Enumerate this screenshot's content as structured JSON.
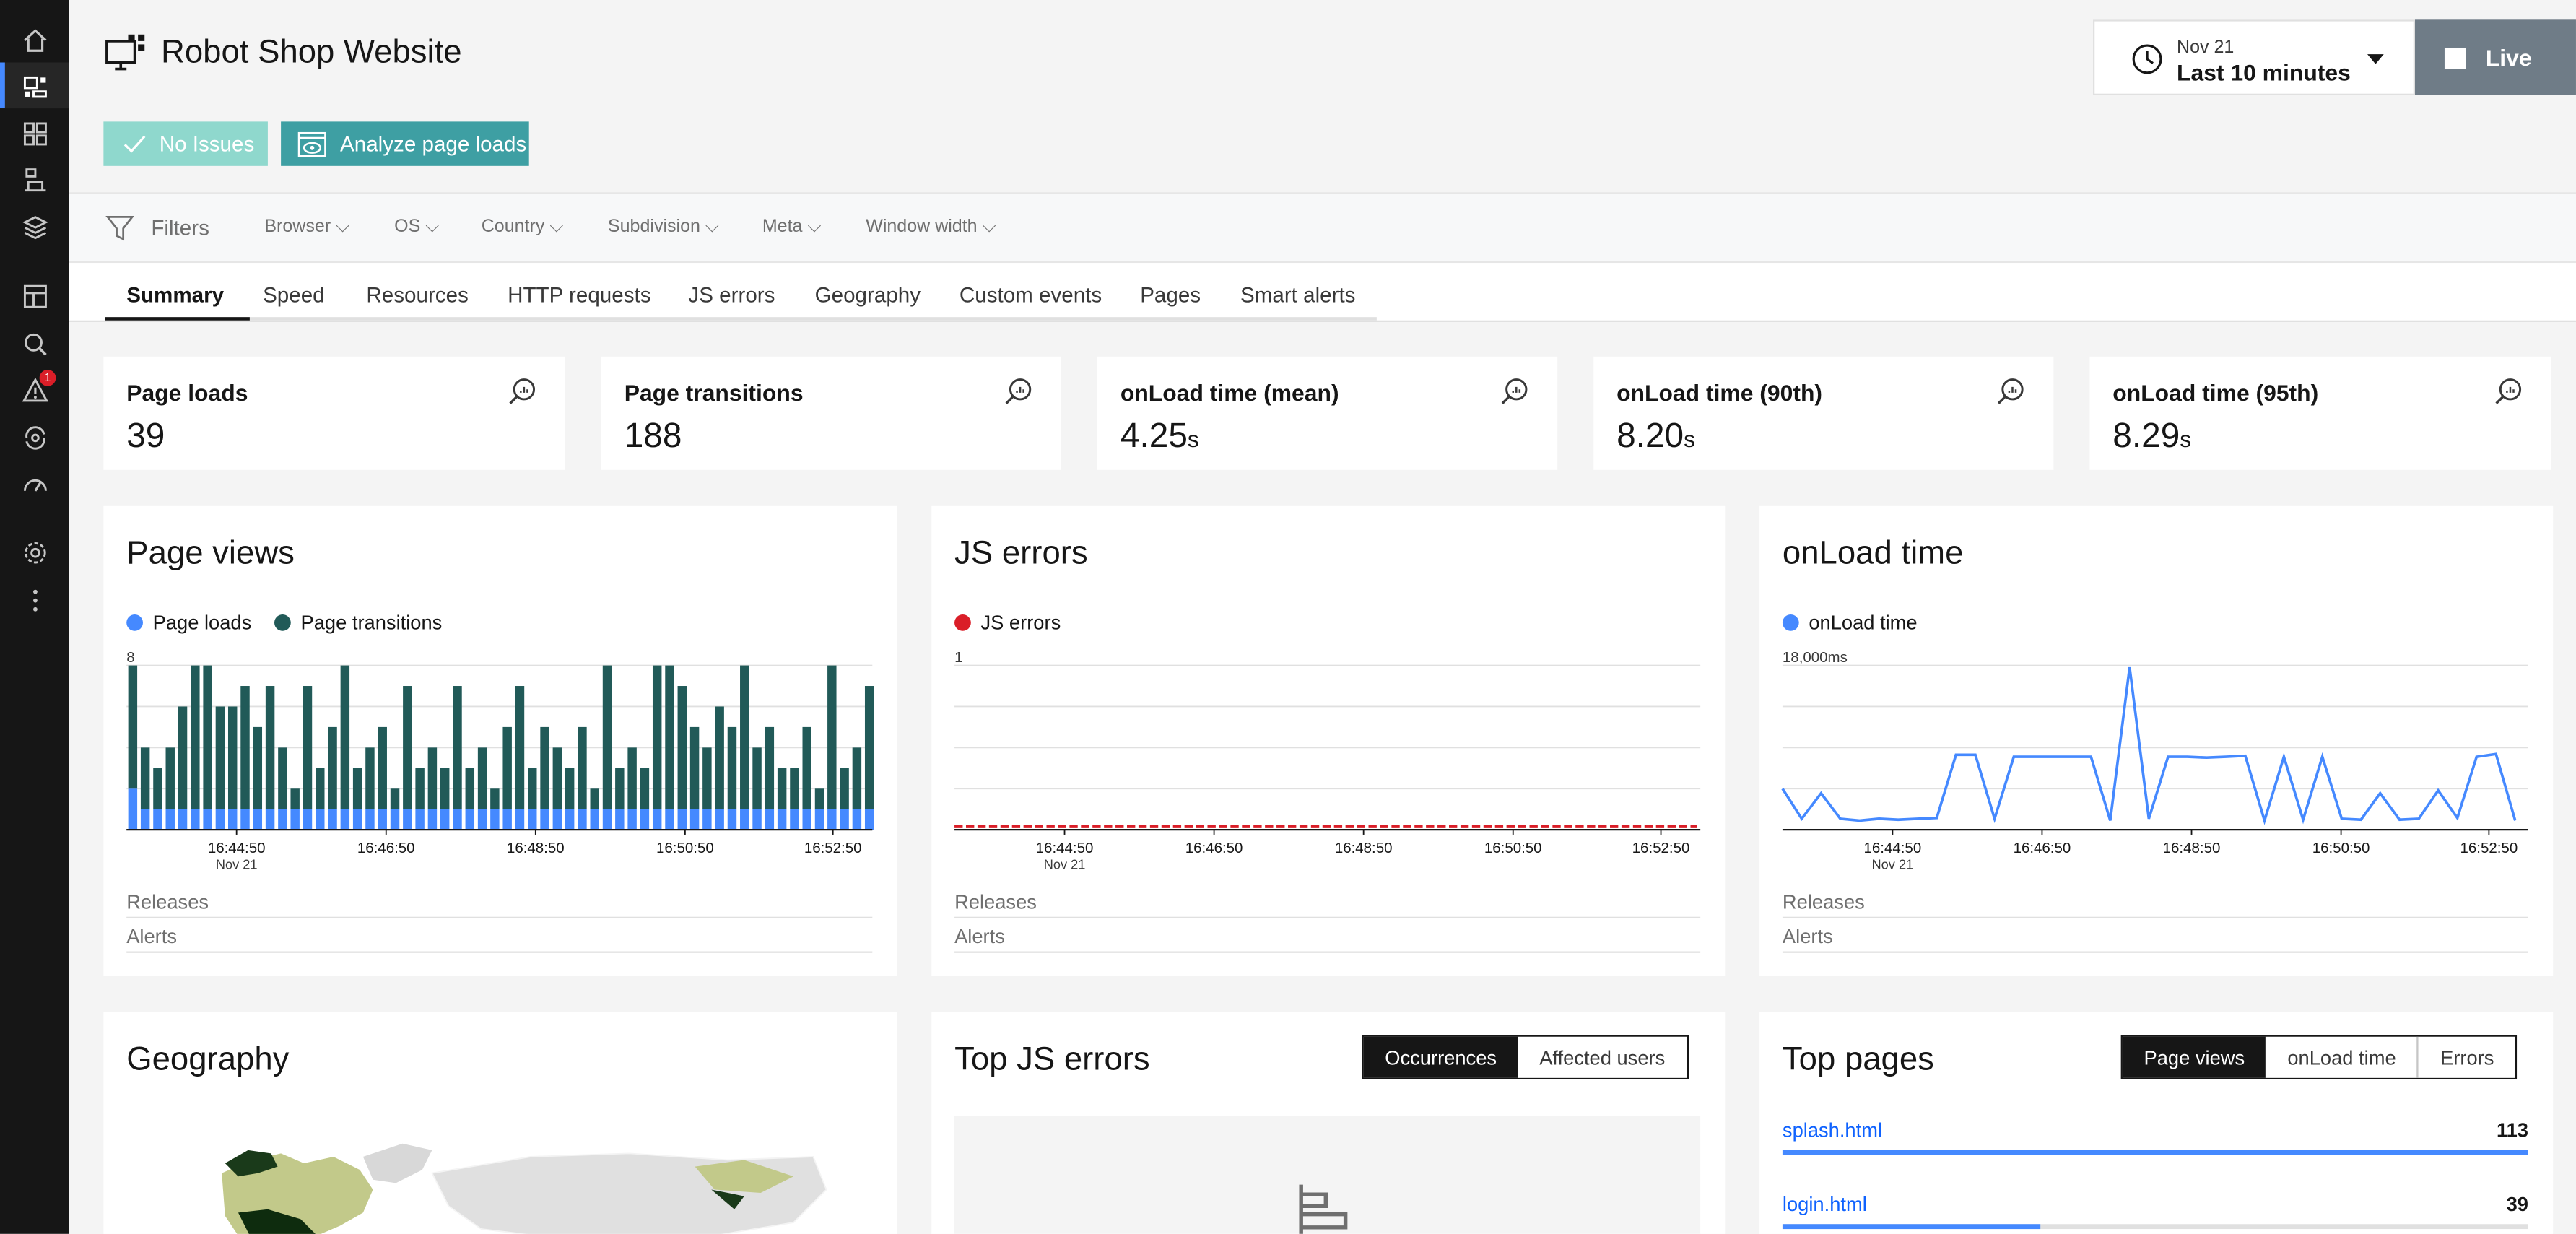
{
  "app": {
    "title": "Robot Shop Website"
  },
  "status": {
    "no_issues": "No Issues",
    "analyze": "Analyze page loads"
  },
  "time": {
    "date": "Nov 21",
    "range": "Last 10 minutes",
    "live": "Live"
  },
  "sidebar": {
    "icons": [
      "home-icon",
      "website-monitoring-icon",
      "applications-icon",
      "infrastructure-icon",
      "platforms-icon",
      "dashboards-icon",
      "analytics-icon",
      "events-icon",
      "automation-icon",
      "performance-icon",
      "settings-icon",
      "more-icon"
    ],
    "alert_count": "1"
  },
  "filters": {
    "label": "Filters",
    "items": [
      "Browser",
      "OS",
      "Country",
      "Subdivision",
      "Meta",
      "Window width"
    ]
  },
  "tabs": [
    "Summary",
    "Speed",
    "Resources",
    "HTTP requests",
    "JS errors",
    "Geography",
    "Custom events",
    "Pages",
    "Smart alerts"
  ],
  "stats": [
    {
      "label": "Page loads",
      "value": "39",
      "unit": ""
    },
    {
      "label": "Page transitions",
      "value": "188",
      "unit": ""
    },
    {
      "label": "onLoad time (mean)",
      "value": "4.25",
      "unit": "s"
    },
    {
      "label": "onLoad time (90th)",
      "value": "8.20",
      "unit": "s"
    },
    {
      "label": "onLoad time (95th)",
      "value": "8.29",
      "unit": "s"
    }
  ],
  "panels": {
    "page_views": {
      "title": "Page views",
      "legend": [
        "Page loads",
        "Page transitions"
      ],
      "ymax": "8"
    },
    "js_errors": {
      "title": "JS errors",
      "legend": [
        "JS errors"
      ],
      "ymax": "1"
    },
    "onload": {
      "title": "onLoad time",
      "legend": [
        "onLoad time"
      ],
      "ymax": "18,000ms"
    },
    "releases": "Releases",
    "alerts": "Alerts"
  },
  "xaxis": {
    "ticks": [
      "16:44:50",
      "16:46:50",
      "16:48:50",
      "16:50:50",
      "16:52:50"
    ],
    "sub": "Nov 21"
  },
  "colors": {
    "page_loads": "#4589ff",
    "page_transitions": "#215a58",
    "js_errors": "#da1e28",
    "onload": "#4589ff"
  },
  "chart_data": [
    {
      "type": "bar",
      "title": "Page views",
      "categories_range": [
        "16:43:30",
        "16:53:30"
      ],
      "ylim": [
        0,
        8
      ],
      "series": [
        {
          "name": "Page loads",
          "values": [
            2,
            1,
            1,
            1,
            1,
            1,
            1,
            1,
            1,
            1,
            1,
            1,
            1,
            1,
            1,
            1,
            1,
            1,
            1,
            1,
            1,
            1,
            1,
            1,
            1,
            1,
            1,
            1,
            1,
            1,
            1,
            1,
            1,
            1,
            1,
            1,
            1,
            1,
            1,
            1,
            1,
            1,
            1,
            1,
            1,
            1,
            1,
            1,
            1,
            1,
            1,
            1,
            1,
            1,
            1,
            1,
            1,
            1,
            1,
            1
          ]
        },
        {
          "name": "Page transitions",
          "values": [
            6,
            3,
            2,
            3,
            5,
            7,
            7,
            5,
            5,
            6,
            4,
            6,
            3,
            1,
            6,
            2,
            4,
            7,
            2,
            3,
            4,
            1,
            6,
            2,
            3,
            2,
            6,
            2,
            3,
            1,
            4,
            6,
            2,
            4,
            3,
            2,
            4,
            1,
            7,
            2,
            3,
            2,
            7,
            7,
            6,
            4,
            3,
            5,
            4,
            7,
            3,
            4,
            2,
            2,
            4,
            1,
            7,
            2,
            3,
            6
          ]
        }
      ]
    },
    {
      "type": "line",
      "title": "JS errors",
      "ylim": [
        0,
        1
      ],
      "series": [
        {
          "name": "JS errors",
          "values": [
            0.02,
            0.02,
            0.02,
            0.02,
            0.02,
            0.02,
            0.02,
            0.02,
            0.02,
            0.02,
            0.02,
            0.02,
            0.02,
            0.02,
            0.02,
            0.02,
            0.02,
            0.02,
            0.02,
            0.02,
            0.02,
            0.02,
            0.02,
            0.02,
            0.02,
            0.02,
            0.02,
            0.02,
            0.02,
            0.02,
            0.02,
            0.02,
            0.02,
            0.02,
            0.02,
            0.02,
            0.02,
            0.02,
            0.02,
            0.02,
            0.02,
            0.02,
            0.02,
            0.02,
            0.02,
            0.02,
            0.02,
            0.02,
            0.02,
            0.02,
            0.02,
            0.02,
            0.02,
            0.02,
            0.02,
            0.02,
            0.02,
            0.02,
            0.02,
            0.02
          ]
        }
      ]
    },
    {
      "type": "line",
      "title": "onLoad time",
      "ylim": [
        0,
        18000
      ],
      "series": [
        {
          "name": "onLoad time",
          "values": [
            4500,
            1200,
            4000,
            1200,
            1000,
            1200,
            1100,
            1200,
            1300,
            8200,
            8200,
            1200,
            8000,
            8000,
            8000,
            8000,
            8000,
            1000,
            17800,
            1200,
            8000,
            8000,
            7900,
            8000,
            8100,
            1000,
            8000,
            1100,
            8000,
            1200,
            1100,
            4000,
            1100,
            1200,
            4300,
            1300,
            8000,
            8300,
            1000
          ]
        }
      ]
    }
  ],
  "geography": {
    "title": "Geography"
  },
  "top_js_errors": {
    "title": "Top JS errors",
    "toggle": [
      "Occurrences",
      "Affected users"
    ]
  },
  "top_pages": {
    "title": "Top pages",
    "toggle": [
      "Page views",
      "onLoad time",
      "Errors"
    ],
    "rows": [
      {
        "name": "splash.html",
        "count": "113",
        "fraction": 1.0
      },
      {
        "name": "login.html",
        "count": "39",
        "fraction": 0.345
      }
    ]
  }
}
